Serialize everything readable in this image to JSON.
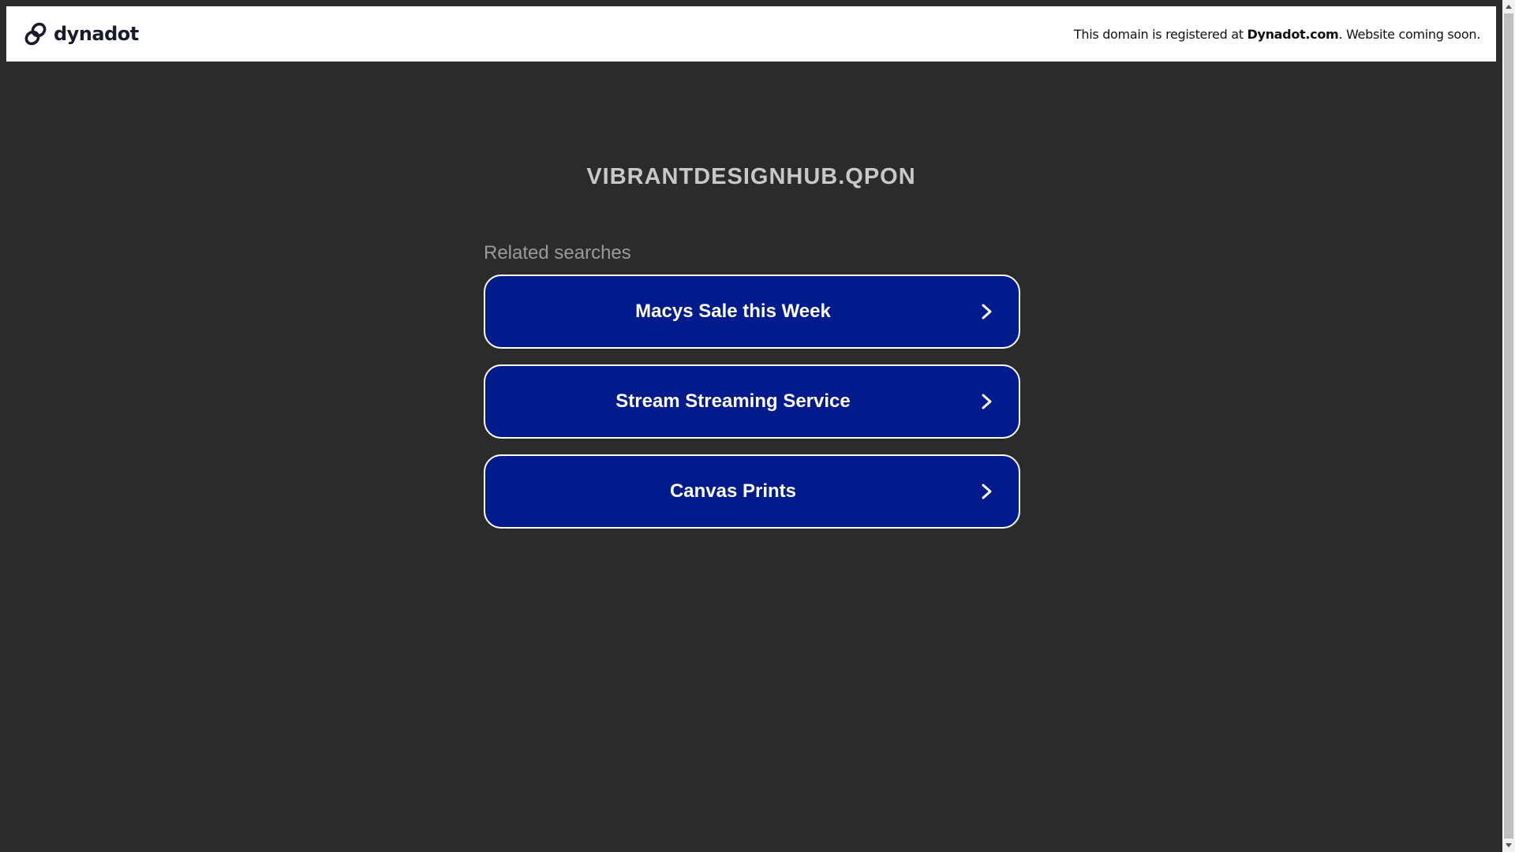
{
  "banner": {
    "logo_text": "dynadot",
    "message_prefix": "This domain is registered at ",
    "message_brand": "Dynadot.com",
    "message_suffix": ". Website coming soon."
  },
  "domain_title": "VIBRANTDESIGNHUB.QPON",
  "related": {
    "heading": "Related searches",
    "items": [
      {
        "label": "Macys Sale this Week"
      },
      {
        "label": "Stream Streaming Service"
      },
      {
        "label": "Canvas Prints"
      }
    ]
  },
  "icons": {
    "logo": "dynadot-link-icon",
    "chevron": "chevron-right-icon"
  },
  "colors": {
    "background": "#2b2b2b",
    "banner_bg": "#ffffff",
    "button_bg": "#011a8c",
    "button_border": "#ffffff",
    "title": "#c8c8c8",
    "heading": "#9a9a9a"
  }
}
